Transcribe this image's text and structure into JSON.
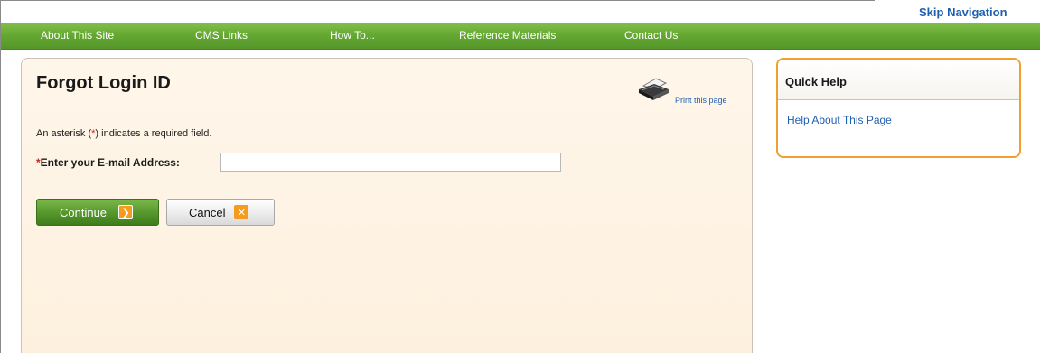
{
  "skip_navigation": "Skip Navigation",
  "nav": {
    "items": [
      {
        "label": "About This Site"
      },
      {
        "label": "CMS Links"
      },
      {
        "label": "How To..."
      },
      {
        "label": "Reference Materials"
      },
      {
        "label": "Contact Us"
      }
    ]
  },
  "main": {
    "title": "Forgot Login ID",
    "print_label": "Print this page",
    "required_note_prefix": "An asterisk (",
    "required_marker": "*",
    "required_note_suffix": ") indicates a required field.",
    "email_label": "Enter your E-mail Address:",
    "email_value": "",
    "continue_label": "Continue",
    "cancel_label": "Cancel"
  },
  "quick_help": {
    "title": "Quick Help",
    "link": "Help About This Page"
  },
  "icons": {
    "print": "printer-icon",
    "continue": "arrow-right-icon",
    "cancel": "close-icon"
  },
  "colors": {
    "nav_green": "#65a832",
    "link_blue": "#1f5fb0",
    "accent_orange": "#f39c1e",
    "panel_bg": "#fff6ea",
    "required_red": "#cc2222"
  }
}
